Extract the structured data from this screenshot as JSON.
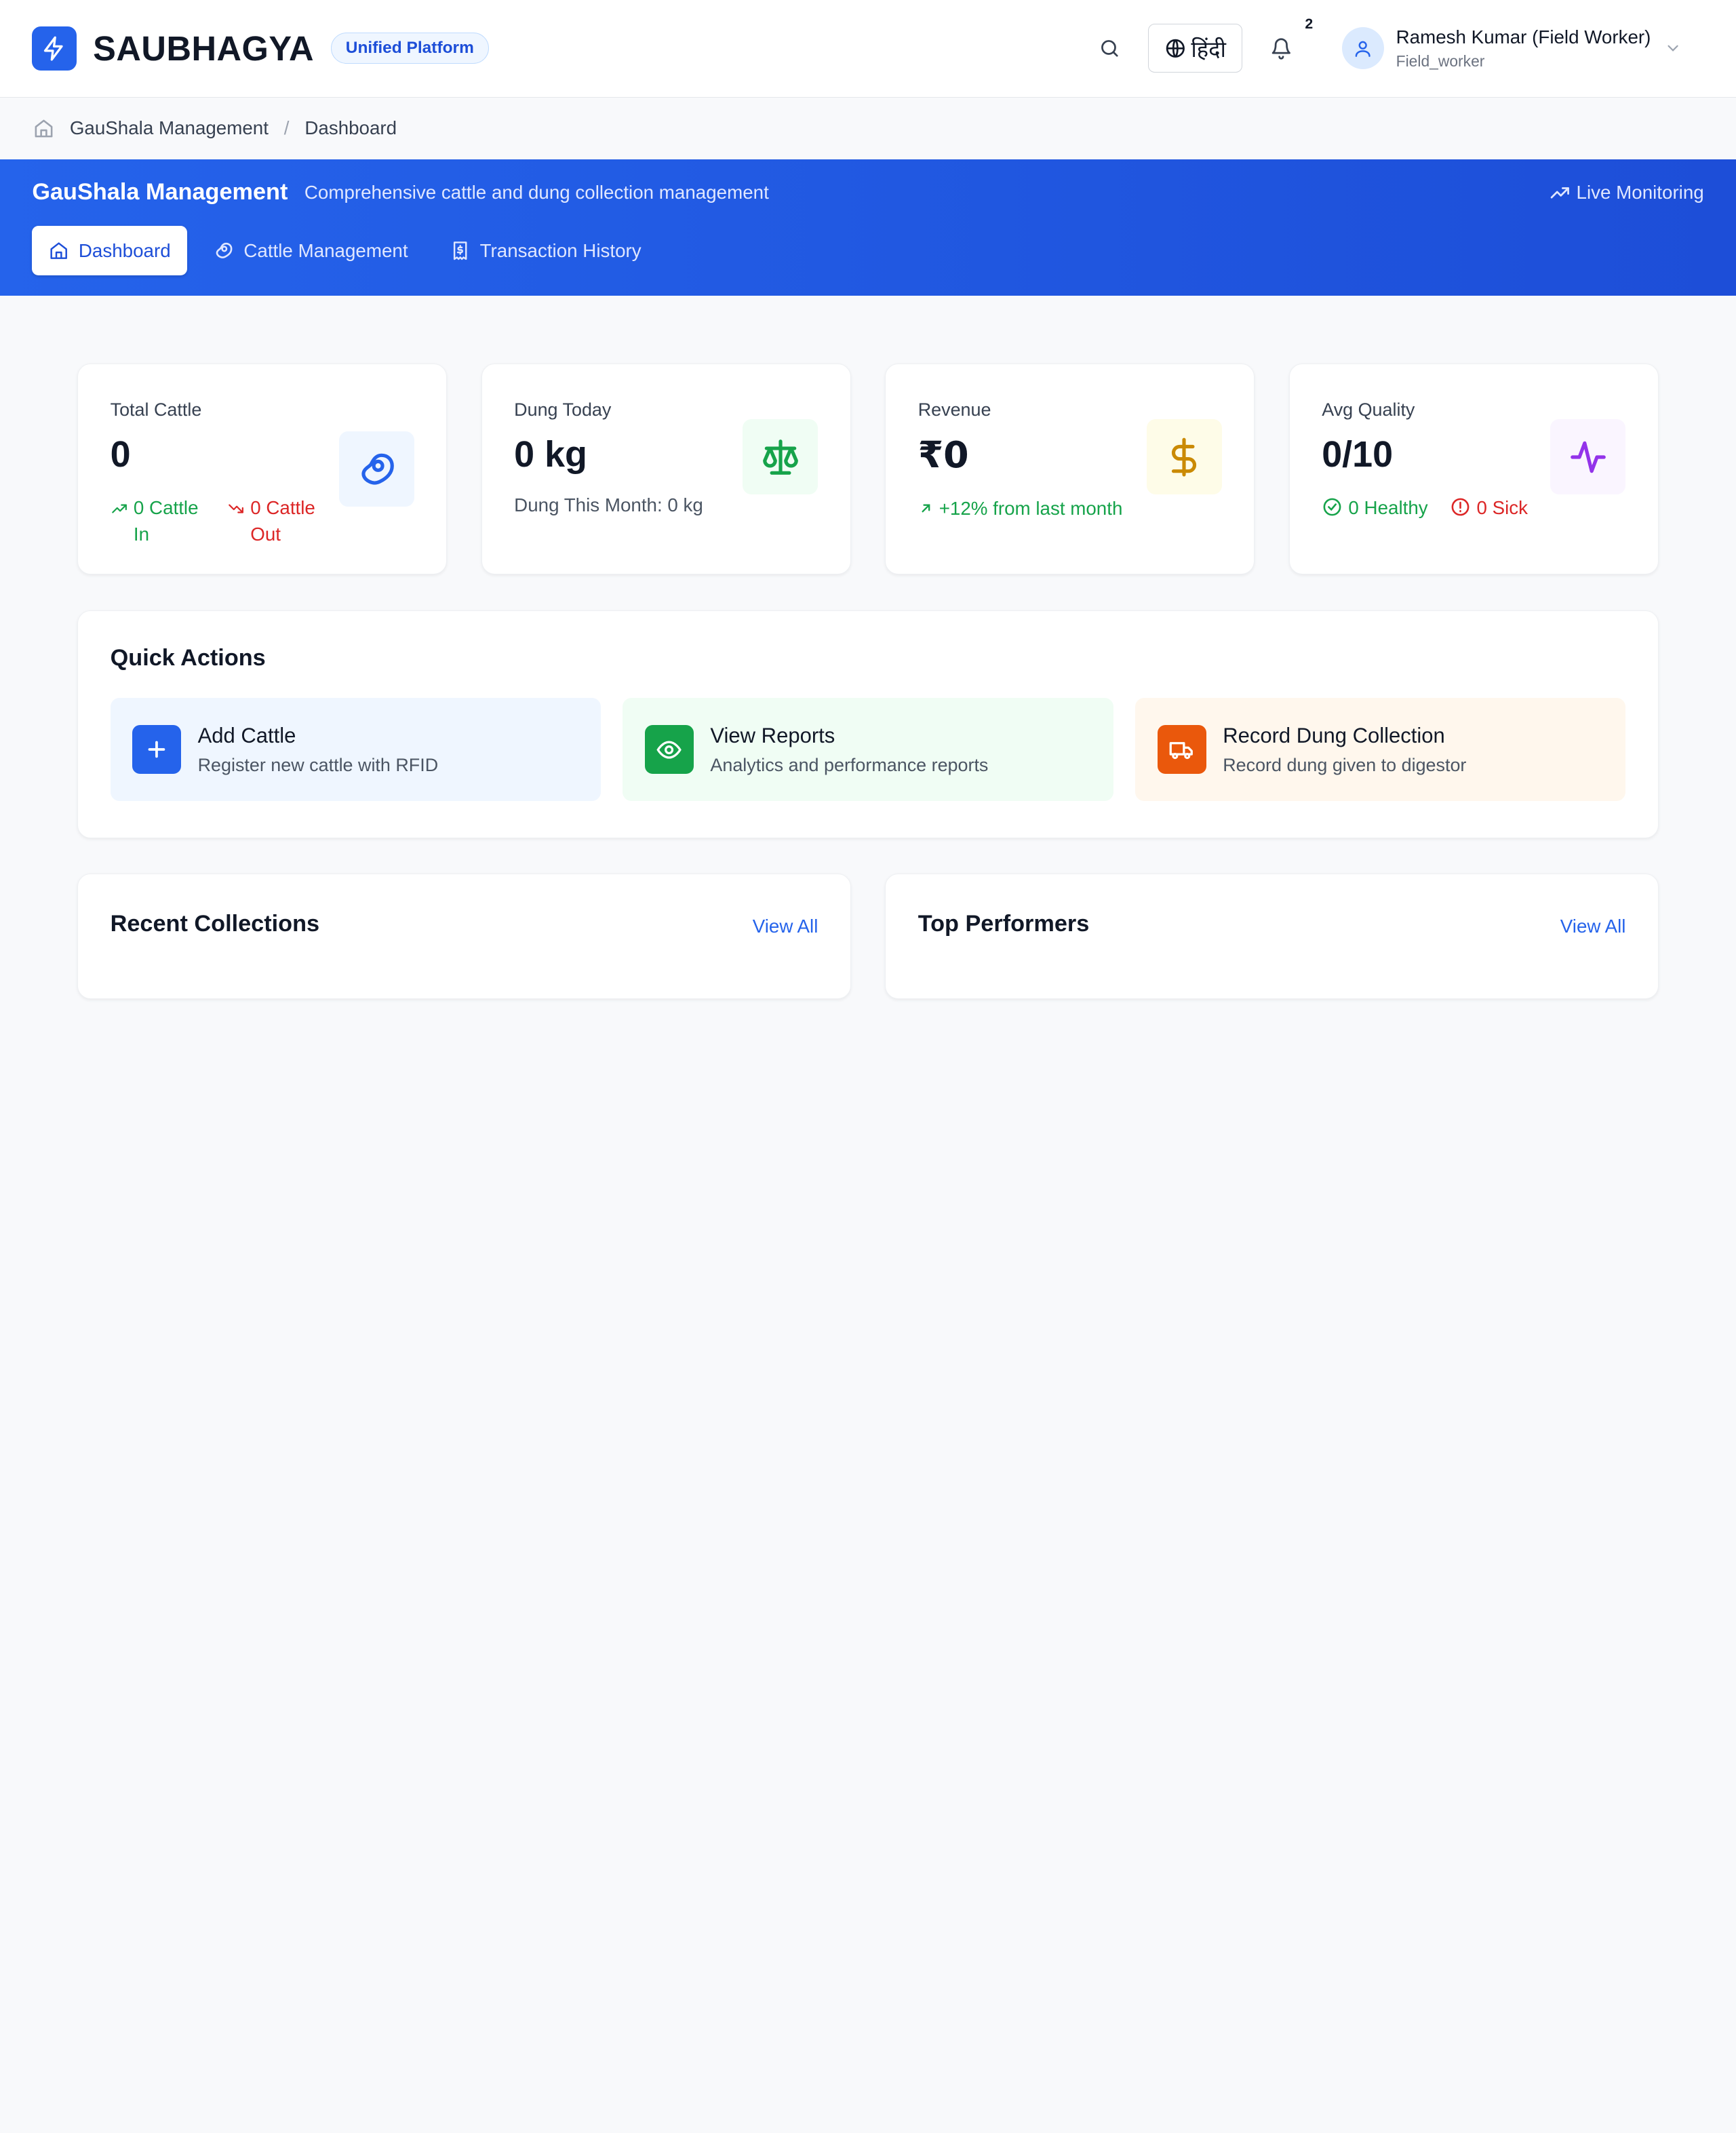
{
  "header": {
    "brand": "SAUBHAGYA",
    "platform_badge": "Unified Platform",
    "language": "हिंदी",
    "notification_count": "2",
    "user_name": "Ramesh Kumar (Field Worker)",
    "user_role": "Field_worker"
  },
  "breadcrumb": {
    "section": "GauShala Management",
    "separator": "/",
    "current": "Dashboard"
  },
  "banner": {
    "title": "GauShala Management",
    "subtitle": "Comprehensive cattle and dung collection management",
    "live": "Live Monitoring",
    "tabs": [
      {
        "label": "Dashboard",
        "icon": "home-icon",
        "active": true
      },
      {
        "label": "Cattle Management",
        "icon": "cattle-icon",
        "active": false
      },
      {
        "label": "Transaction History",
        "icon": "receipt-icon",
        "active": false
      }
    ]
  },
  "stats": {
    "total_cattle": {
      "label": "Total Cattle",
      "value": "0",
      "in_label": "0 Cattle In",
      "in_line1": "0 Cattle",
      "in_line2": "In",
      "out_label": "0 Cattle Out",
      "out_line1": "0 Cattle",
      "out_line2": "Out",
      "icon": "cattle-icon",
      "icon_bg": "#eff6ff",
      "icon_color": "#2563eb"
    },
    "dung_today": {
      "label": "Dung Today",
      "value": "0 kg",
      "sub": "Dung This Month: 0 kg",
      "icon": "scale-icon",
      "icon_bg": "#f0fdf4",
      "icon_color": "#16a34a"
    },
    "revenue": {
      "label": "Revenue",
      "value": "₹0",
      "sub": "+12% from last month",
      "icon": "dollar-icon",
      "icon_bg": "#fefce8",
      "icon_color": "#ca8a04"
    },
    "avg_quality": {
      "label": "Avg Quality",
      "value": "0/10",
      "healthy": "0 Healthy",
      "sick": "0 Sick",
      "icon": "activity-icon",
      "icon_bg": "#faf5ff",
      "icon_color": "#9333ea"
    }
  },
  "quick_actions": {
    "title": "Quick Actions",
    "items": [
      {
        "title": "Add Cattle",
        "desc": "Register new cattle with RFID",
        "icon": "plus-icon",
        "bg": "#eff6ff",
        "icon_bg": "#2563eb"
      },
      {
        "title": "View Reports",
        "desc": "Analytics and performance reports",
        "icon": "eye-icon",
        "bg": "#f0fdf4",
        "icon_bg": "#16a34a"
      },
      {
        "title": "Record Dung Collection",
        "desc": "Record dung given to digestor",
        "icon": "truck-icon",
        "bg": "#fff7ed",
        "icon_bg": "#ea580c"
      }
    ]
  },
  "panels": {
    "recent": {
      "title": "Recent Collections",
      "action": "View All"
    },
    "top": {
      "title": "Top Performers",
      "action": "View All"
    }
  }
}
